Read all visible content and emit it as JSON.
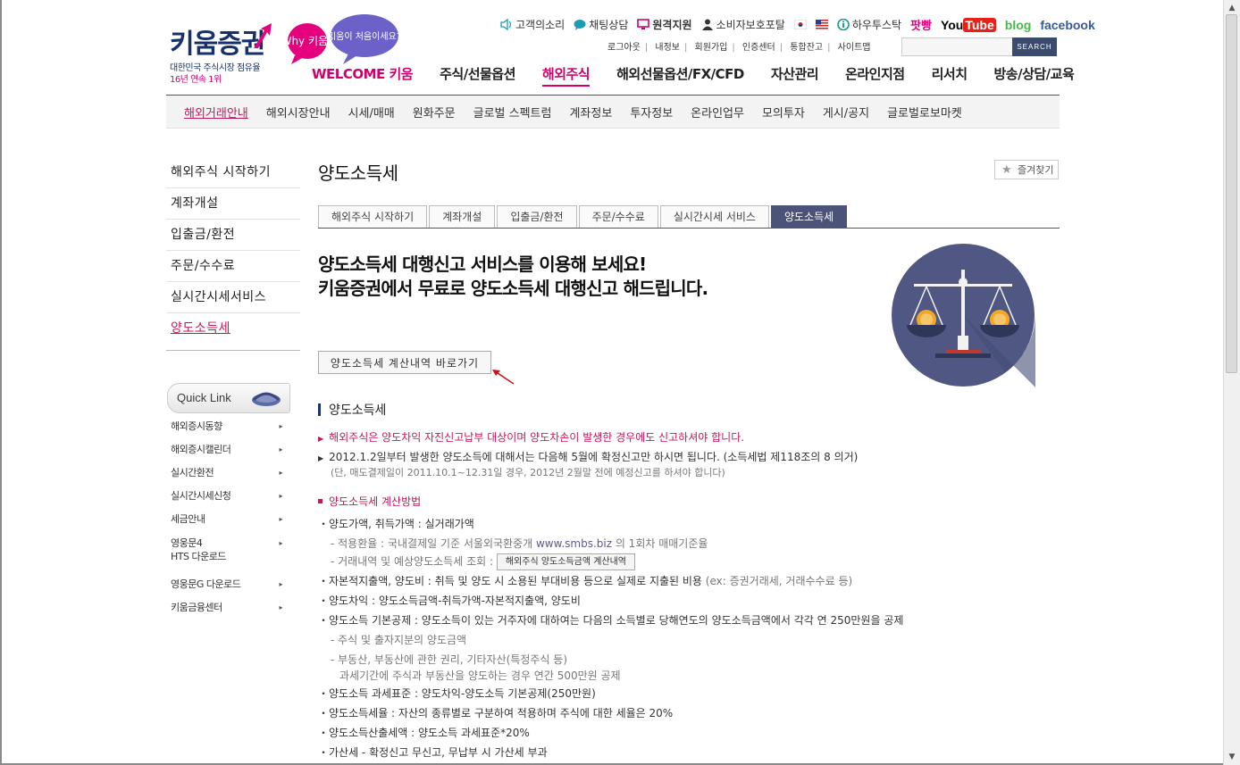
{
  "header": {
    "logo_text": "키움증권",
    "logo_sub1": "대한민국 주식시장 점유율",
    "logo_sub2": "16년 연속 1위",
    "bubble1": "Why 키움?",
    "bubble2": "키움이 처음이세요?",
    "util": {
      "voice": "고객의소리",
      "chat": "채팅상담",
      "remote": "원격지원",
      "consumer": "소비자보호포탈",
      "howto": "하우투스탁",
      "ppang": "팟빵",
      "youtube_you": "You",
      "youtube_tube": "Tube",
      "blog": "blog",
      "facebook": "facebook"
    },
    "links": [
      "로그아웃",
      "내정보",
      "회원가입",
      "인증센터",
      "통합잔고",
      "사이트맵"
    ],
    "search_btn": "SEARCH",
    "gnb": [
      "WELCOME 키움",
      "주식/선물옵션",
      "해외주식",
      "해외선물옵션/FX/CFD",
      "자산관리",
      "온라인지점",
      "리서치",
      "방송/상담/교육"
    ]
  },
  "lnb": [
    "해외거래안내",
    "해외시장안내",
    "시세/매매",
    "원화주문",
    "글로벌 스펙트럼",
    "계좌정보",
    "투자정보",
    "온라인업무",
    "모의투자",
    "게시/공지",
    "글로벌로보마켓"
  ],
  "side": [
    "해외주식 시작하기",
    "계좌개설",
    "입출금/환전",
    "주문/수수료",
    "실시간시세서비스",
    "양도소득세"
  ],
  "quick_link": {
    "title": "Quick Link",
    "items": [
      "해외증시동향",
      "해외증시캘린더",
      "실시간환전",
      "실시간시세신청",
      "세금안내",
      "영웅문4",
      "HTS 다운로드",
      "영웅문G 다운로드",
      "키움금융센터"
    ]
  },
  "main": {
    "title": "양도소득세",
    "fav": "즐겨찾기",
    "tabs": [
      "해외주식 시작하기",
      "계좌개설",
      "입출금/환전",
      "주문/수수료",
      "실시간시세 서비스",
      "양도소득세"
    ],
    "headline1": "양도소득세 대행신고 서비스를 이용해 보세요!",
    "headline2": "키움증권에서 무료로 양도소득세 대행신고 해드립니다.",
    "go_btn": "양도소득세 계산내역 바로가기",
    "section_title": "양도소득세",
    "notice1": "해외주식은 양도차익 자진신고납부 대상이며 양도차손이 발생한 경우에도 신고하셔야 합니다.",
    "notice2": "2012.1.2일부터 발생한 양도소득에 대해서는 다음해 5월에 확정신고만 하시면 됩니다. (소득세법 제118조의 8 의거)",
    "notice2_sub": "(단, 매도결제일이 2011.10.1~12.31일 경우, 2012년 2월말 전에 예정신고를 하셔야 합니다)",
    "calc_title": "양도소득세 계산방법",
    "l1": "・양도가액, 취득가액 : 실거래가액",
    "l1a_pre": "- 적용환율 : 국내결제일 기준 서울외국환중개 ",
    "l1a_link": "www.smbs.biz",
    "l1a_post": " 의 1회차 매매기준율",
    "l1b": "- 거래내역 및 예상양도소득세 조회 :",
    "l1b_btn": "해외주식 양도소득금액 계산내역",
    "l2_pre": "・자본적지출액, 양도비 : 취득 및 양도 시 소용된 부대비용 등으로 실제로 지출된 비용 ",
    "l2_gray": "(ex: 증권거래세, 거래수수료 등)",
    "l3": "・양도차익 : 양도소득금액-취득가액-자본적지출액, 양도비",
    "l4": "・양도소득 기본공제 : 양도소득이 있는 거주자에 대하여는 다음의 소득별로 당해연도의 양도소득금액에서 각각 연 250만원을 공제",
    "l4a": "- 주식 및 출자지분의 양도금액",
    "l4b": "- 부동산, 부동산에 관한 권리, 기타자산(특정주식 등)",
    "l4c": "과세기간에 주식과 부동산을 양도하는 경우 연간 500만원 공제",
    "l5": "・양도소득 과세표준 : 양도차익-양도소득 기본공제(250만원)",
    "l6": "・양도소득세율 : 자산의 종류별로 구분하여 적용하며 주식에 대한 세율은 20%",
    "l7": "・양도소득산출세액 : 양도소득 과세표준*20%",
    "l8": "・가산세 - 확정신고 무신고, 무납부 시 가산세 부과"
  },
  "colors": {
    "brand_navy": "#15306b",
    "accent_pink": "#d2006e",
    "tab_active": "#4b5378"
  }
}
